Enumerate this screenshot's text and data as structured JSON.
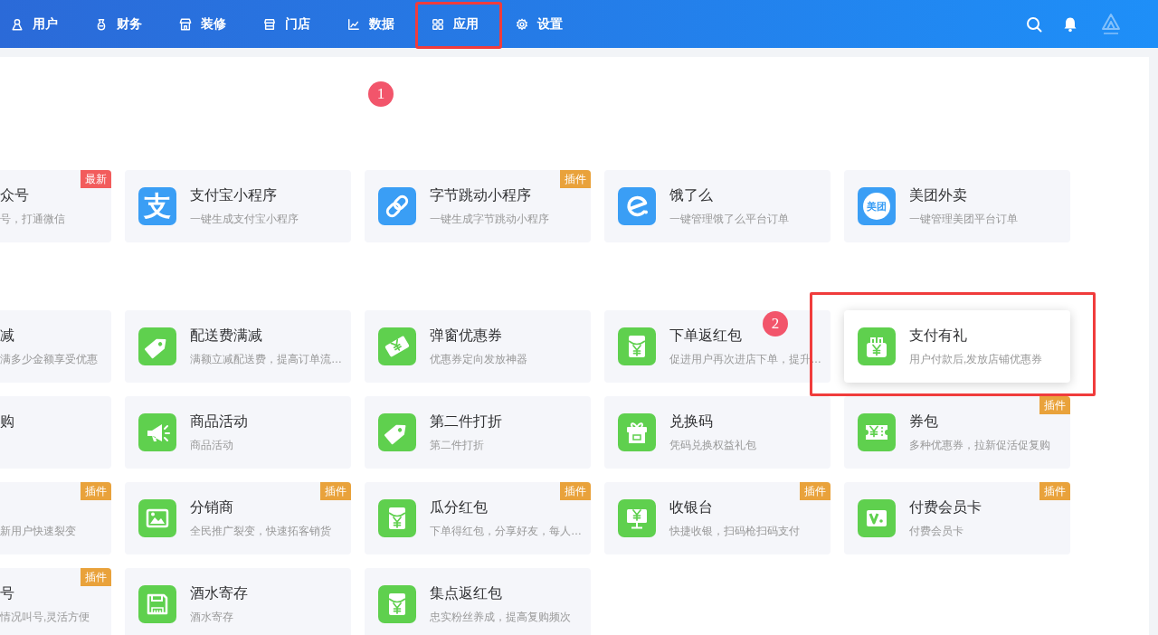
{
  "nav": {
    "items": [
      {
        "label": "用户",
        "highlighted": false
      },
      {
        "label": "财务",
        "highlighted": false
      },
      {
        "label": "装修",
        "highlighted": false
      },
      {
        "label": "门店",
        "highlighted": false
      },
      {
        "label": "数据",
        "highlighted": false
      },
      {
        "label": "应用",
        "highlighted": true
      },
      {
        "label": "设置",
        "highlighted": false
      }
    ]
  },
  "panel": {
    "marker": "1",
    "sections": [
      {
        "cards": [
          {
            "kind": "partial",
            "title": "众号",
            "subtitle": "号，打通微信",
            "badge": {
              "kind": "new",
              "text": "最新"
            },
            "highlighted": false
          },
          {
            "kind": "full",
            "title": "支付宝小程序",
            "subtitle": "一键生成支付宝小程序",
            "logo": {
              "kind": "plain",
              "text": "支"
            },
            "highlighted": false
          },
          {
            "kind": "full",
            "title": "字节跳动小程序",
            "subtitle": "一键生成字节跳动小程序",
            "badge": {
              "kind": "plugin",
              "text": "插件"
            },
            "highlighted": false
          },
          {
            "kind": "full",
            "title": "饿了么",
            "subtitle": "一键管理饿了么平台订单",
            "highlighted": false
          },
          {
            "kind": "full",
            "title": "美团外卖",
            "subtitle": "一键管理美团平台订单",
            "logo": {
              "kind": "circle",
              "text": "美团"
            },
            "highlighted": false
          }
        ]
      },
      {
        "cards": [
          {
            "kind": "partial",
            "title": "减",
            "subtitle": "满多少金额享受优惠",
            "highlighted": false
          },
          {
            "kind": "full",
            "title": "配送费满减",
            "subtitle": "满额立减配送费，提高订单流…",
            "highlighted": false
          },
          {
            "kind": "full",
            "title": "弹窗优惠券",
            "subtitle": "优惠券定向发放神器",
            "highlighted": false
          },
          {
            "kind": "full",
            "title": "下单返红包",
            "subtitle": "促进用户再次进店下单，提升…",
            "marker": "2",
            "highlighted": false
          },
          {
            "kind": "full",
            "title": "支付有礼",
            "subtitle": "用户付款后,发放店铺优惠券",
            "highlighted": true
          },
          {
            "kind": "partial",
            "title": "购",
            "highlighted": false
          },
          {
            "kind": "full",
            "title": "商品活动",
            "subtitle": "商品活动",
            "highlighted": false
          },
          {
            "kind": "full",
            "title": "第二件打折",
            "subtitle": "第二件打折",
            "highlighted": false
          },
          {
            "kind": "full",
            "title": "兑换码",
            "subtitle": "凭码兑换权益礼包",
            "highlighted": false
          },
          {
            "kind": "full",
            "title": "券包",
            "subtitle": "多种优惠券，拉新促活促复购",
            "badge": {
              "kind": "plugin",
              "text": "插件"
            },
            "highlighted": false
          },
          {
            "kind": "partial",
            "subtitle": "新用户快速裂变",
            "badge": {
              "kind": "plugin",
              "text": "插件"
            },
            "highlighted": false
          },
          {
            "kind": "full",
            "title": "分销商",
            "subtitle": "全民推广裂变，快速拓客销货",
            "badge": {
              "kind": "plugin",
              "text": "插件"
            },
            "highlighted": false
          },
          {
            "kind": "full",
            "title": "瓜分红包",
            "subtitle": "下单得红包，分享好友，每人…",
            "badge": {
              "kind": "plugin",
              "text": "插件"
            },
            "highlighted": false
          },
          {
            "kind": "full",
            "title": "收银台",
            "subtitle": "快捷收银，扫码枪扫码支付",
            "badge": {
              "kind": "plugin",
              "text": "插件"
            },
            "highlighted": false
          },
          {
            "kind": "full",
            "title": "付费会员卡",
            "subtitle": "付费会员卡",
            "badge": {
              "kind": "plugin",
              "text": "插件"
            },
            "highlighted": false
          },
          {
            "kind": "partial",
            "title": "号",
            "subtitle": "情况叫号,灵活方便",
            "badge": {
              "kind": "plugin",
              "text": "插件"
            },
            "highlighted": false
          },
          {
            "kind": "full",
            "title": "酒水寄存",
            "subtitle": "酒水寄存",
            "highlighted": false
          },
          {
            "kind": "full",
            "title": "集点返红包",
            "subtitle": "忠实粉丝养成，提高复购频次",
            "highlighted": false
          }
        ]
      }
    ]
  }
}
